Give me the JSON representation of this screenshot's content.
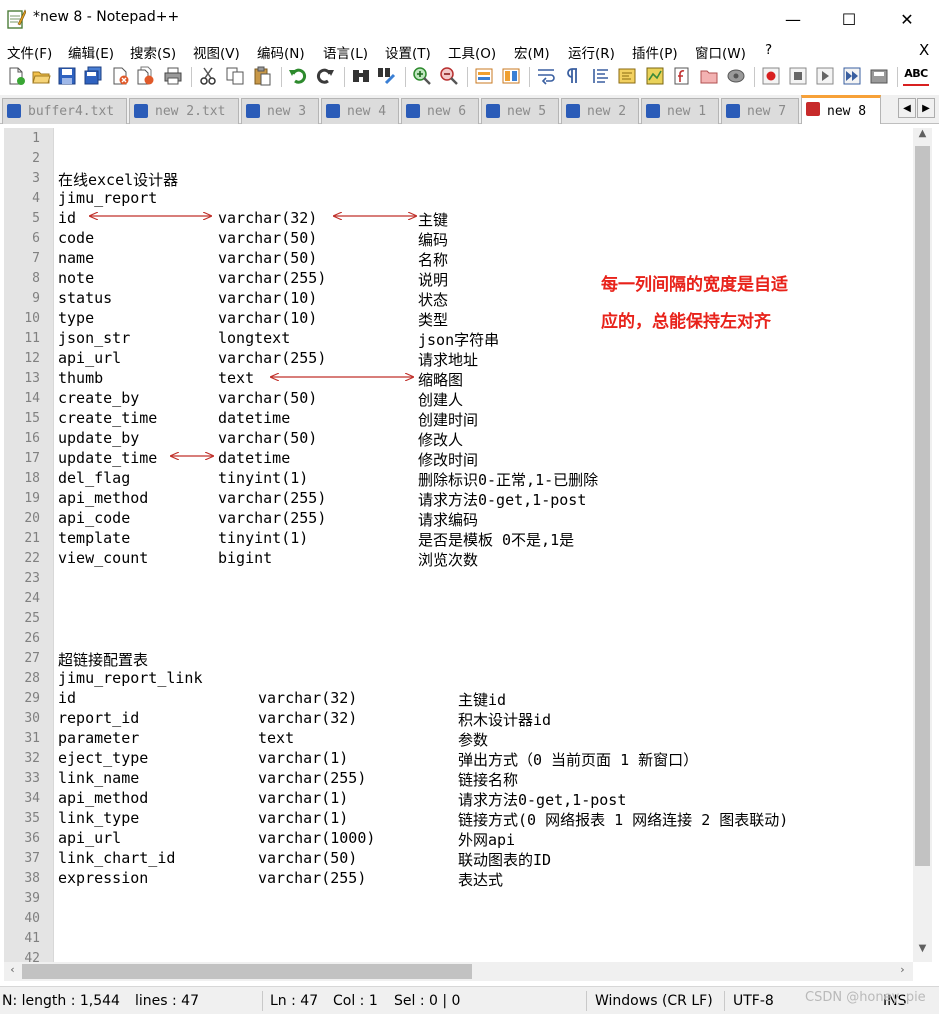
{
  "window": {
    "title": "*new 8 - Notepad++",
    "minimize_glyph": "—",
    "maximize_glyph": "☐",
    "close_glyph": "✕"
  },
  "menu": [
    "文件(F)",
    "编辑(E)",
    "搜索(S)",
    "视图(V)",
    "编码(N)",
    "语言(L)",
    "设置(T)",
    "工具(O)",
    "宏(M)",
    "运行(R)",
    "插件(P)",
    "窗口(W)",
    "?"
  ],
  "menu_close": "X",
  "toolbar": {
    "icons": [
      "new-file-icon",
      "open-file-icon",
      "save-icon",
      "save-all-icon",
      "close-icon",
      "close-all-icon",
      "print-icon",
      "cut-icon",
      "copy-icon",
      "paste-icon",
      "undo-icon",
      "redo-icon",
      "find-icon",
      "replace-icon",
      "zoom-in-icon",
      "zoom-out-icon",
      "sync-vertical-icon",
      "sync-horizontal-icon",
      "word-wrap-icon",
      "show-all-chars-icon",
      "indent-guide-icon",
      "language-panel-icon",
      "document-map-icon",
      "function-list-icon",
      "folder-workspace-icon",
      "monitoring-icon",
      "record-macro-icon",
      "stop-macro-icon",
      "play-macro-icon",
      "run-macro-multiple-icon",
      "save-macro-icon",
      "spell-check-icon"
    ],
    "spell_label": "ABC"
  },
  "tabs": [
    {
      "label": "buffer4.txt",
      "active": false,
      "saved": true
    },
    {
      "label": "new 2.txt",
      "active": false,
      "saved": true
    },
    {
      "label": "new 3",
      "active": false,
      "saved": false
    },
    {
      "label": "new 4",
      "active": false,
      "saved": false
    },
    {
      "label": "new 6",
      "active": false,
      "saved": false
    },
    {
      "label": "new 5",
      "active": false,
      "saved": false
    },
    {
      "label": "new 2",
      "active": false,
      "saved": false
    },
    {
      "label": "new 1",
      "active": false,
      "saved": false
    },
    {
      "label": "new 7",
      "active": false,
      "saved": false
    },
    {
      "label": "new 8",
      "active": true,
      "saved": false
    }
  ],
  "tab_nav": {
    "left": "◀",
    "right": "▶"
  },
  "editor": {
    "lines": [
      {
        "n": "1",
        "c": []
      },
      {
        "n": "2",
        "c": []
      },
      {
        "n": "3",
        "c": [
          "在线excel设计器"
        ]
      },
      {
        "n": "4",
        "c": [
          "jimu_report"
        ]
      },
      {
        "n": "5",
        "c": [
          "id",
          "varchar(32)",
          "主键"
        ]
      },
      {
        "n": "6",
        "c": [
          "code",
          "varchar(50)",
          "编码"
        ]
      },
      {
        "n": "7",
        "c": [
          "name",
          "varchar(50)",
          "名称"
        ]
      },
      {
        "n": "8",
        "c": [
          "note",
          "varchar(255)",
          "说明"
        ]
      },
      {
        "n": "9",
        "c": [
          "status",
          "varchar(10)",
          "状态"
        ]
      },
      {
        "n": "10",
        "c": [
          "type",
          "varchar(10)",
          "类型"
        ]
      },
      {
        "n": "11",
        "c": [
          "json_str",
          "longtext",
          "json字符串"
        ]
      },
      {
        "n": "12",
        "c": [
          "api_url",
          "varchar(255)",
          "请求地址"
        ]
      },
      {
        "n": "13",
        "c": [
          "thumb",
          "text",
          "缩略图"
        ]
      },
      {
        "n": "14",
        "c": [
          "create_by",
          "varchar(50)",
          "创建人"
        ]
      },
      {
        "n": "15",
        "c": [
          "create_time",
          "datetime",
          "创建时间"
        ]
      },
      {
        "n": "16",
        "c": [
          "update_by",
          "varchar(50)",
          "修改人"
        ]
      },
      {
        "n": "17",
        "c": [
          "update_time",
          "datetime",
          "修改时间"
        ]
      },
      {
        "n": "18",
        "c": [
          "del_flag",
          "tinyint(1)",
          "删除标识0-正常,1-已删除"
        ]
      },
      {
        "n": "19",
        "c": [
          "api_method",
          "varchar(255)",
          "请求方法0-get,1-post"
        ]
      },
      {
        "n": "20",
        "c": [
          "api_code",
          "varchar(255)",
          "请求编码"
        ]
      },
      {
        "n": "21",
        "c": [
          "template",
          "tinyint(1)",
          "是否是模板 0不是,1是"
        ]
      },
      {
        "n": "22",
        "c": [
          "view_count",
          "bigint",
          "浏览次数"
        ]
      },
      {
        "n": "23",
        "c": []
      },
      {
        "n": "24",
        "c": []
      },
      {
        "n": "25",
        "c": []
      },
      {
        "n": "26",
        "c": []
      },
      {
        "n": "27",
        "c": [
          "超链接配置表"
        ]
      },
      {
        "n": "28",
        "c": [
          "jimu_report_link"
        ]
      },
      {
        "n": "29",
        "c": [
          "id",
          "varchar(32)",
          "主键id"
        ]
      },
      {
        "n": "30",
        "c": [
          "report_id",
          "varchar(32)",
          "积木设计器id"
        ]
      },
      {
        "n": "31",
        "c": [
          "parameter",
          "text",
          "参数"
        ]
      },
      {
        "n": "32",
        "c": [
          "eject_type",
          "varchar(1)",
          "弹出方式（0 当前页面 1 新窗口）"
        ]
      },
      {
        "n": "33",
        "c": [
          "link_name",
          "varchar(255)",
          "链接名称"
        ]
      },
      {
        "n": "34",
        "c": [
          "api_method",
          "varchar(1)",
          "请求方法0-get,1-post"
        ]
      },
      {
        "n": "35",
        "c": [
          "link_type",
          "varchar(1)",
          "链接方式(0 网络报表 1 网络连接 2 图表联动)"
        ]
      },
      {
        "n": "36",
        "c": [
          "api_url",
          "varchar(1000)",
          "外网api"
        ]
      },
      {
        "n": "37",
        "c": [
          "link_chart_id",
          "varchar(50)",
          "联动图表的ID"
        ]
      },
      {
        "n": "38",
        "c": [
          "expression",
          "varchar(255)",
          "表达式"
        ]
      },
      {
        "n": "39",
        "c": []
      },
      {
        "n": "40",
        "c": []
      },
      {
        "n": "41",
        "c": []
      },
      {
        "n": "42",
        "c": []
      }
    ],
    "annotation": [
      "每一列间隔的宽度是自适",
      "应的，总能保持左对齐"
    ],
    "annotation_color": "#e8221a",
    "arrow_color": "#c0302a"
  },
  "statusbar": {
    "length": "N: length : 1,544",
    "lines": "lines : 47",
    "position": "Ln : 47",
    "column": "Col : 1",
    "selection": "Sel : 0 | 0",
    "eol": "Windows (CR LF)",
    "encoding": "UTF-8",
    "mode": "INS",
    "watermark": "CSDN @honey_pie"
  },
  "colors": {
    "active_tab_accent": "#f7a138",
    "gutter_bg": "#e4e4e4",
    "tab_saved_icon": "#2b5cb8",
    "tab_unsaved_icon": "#c72a2a"
  }
}
